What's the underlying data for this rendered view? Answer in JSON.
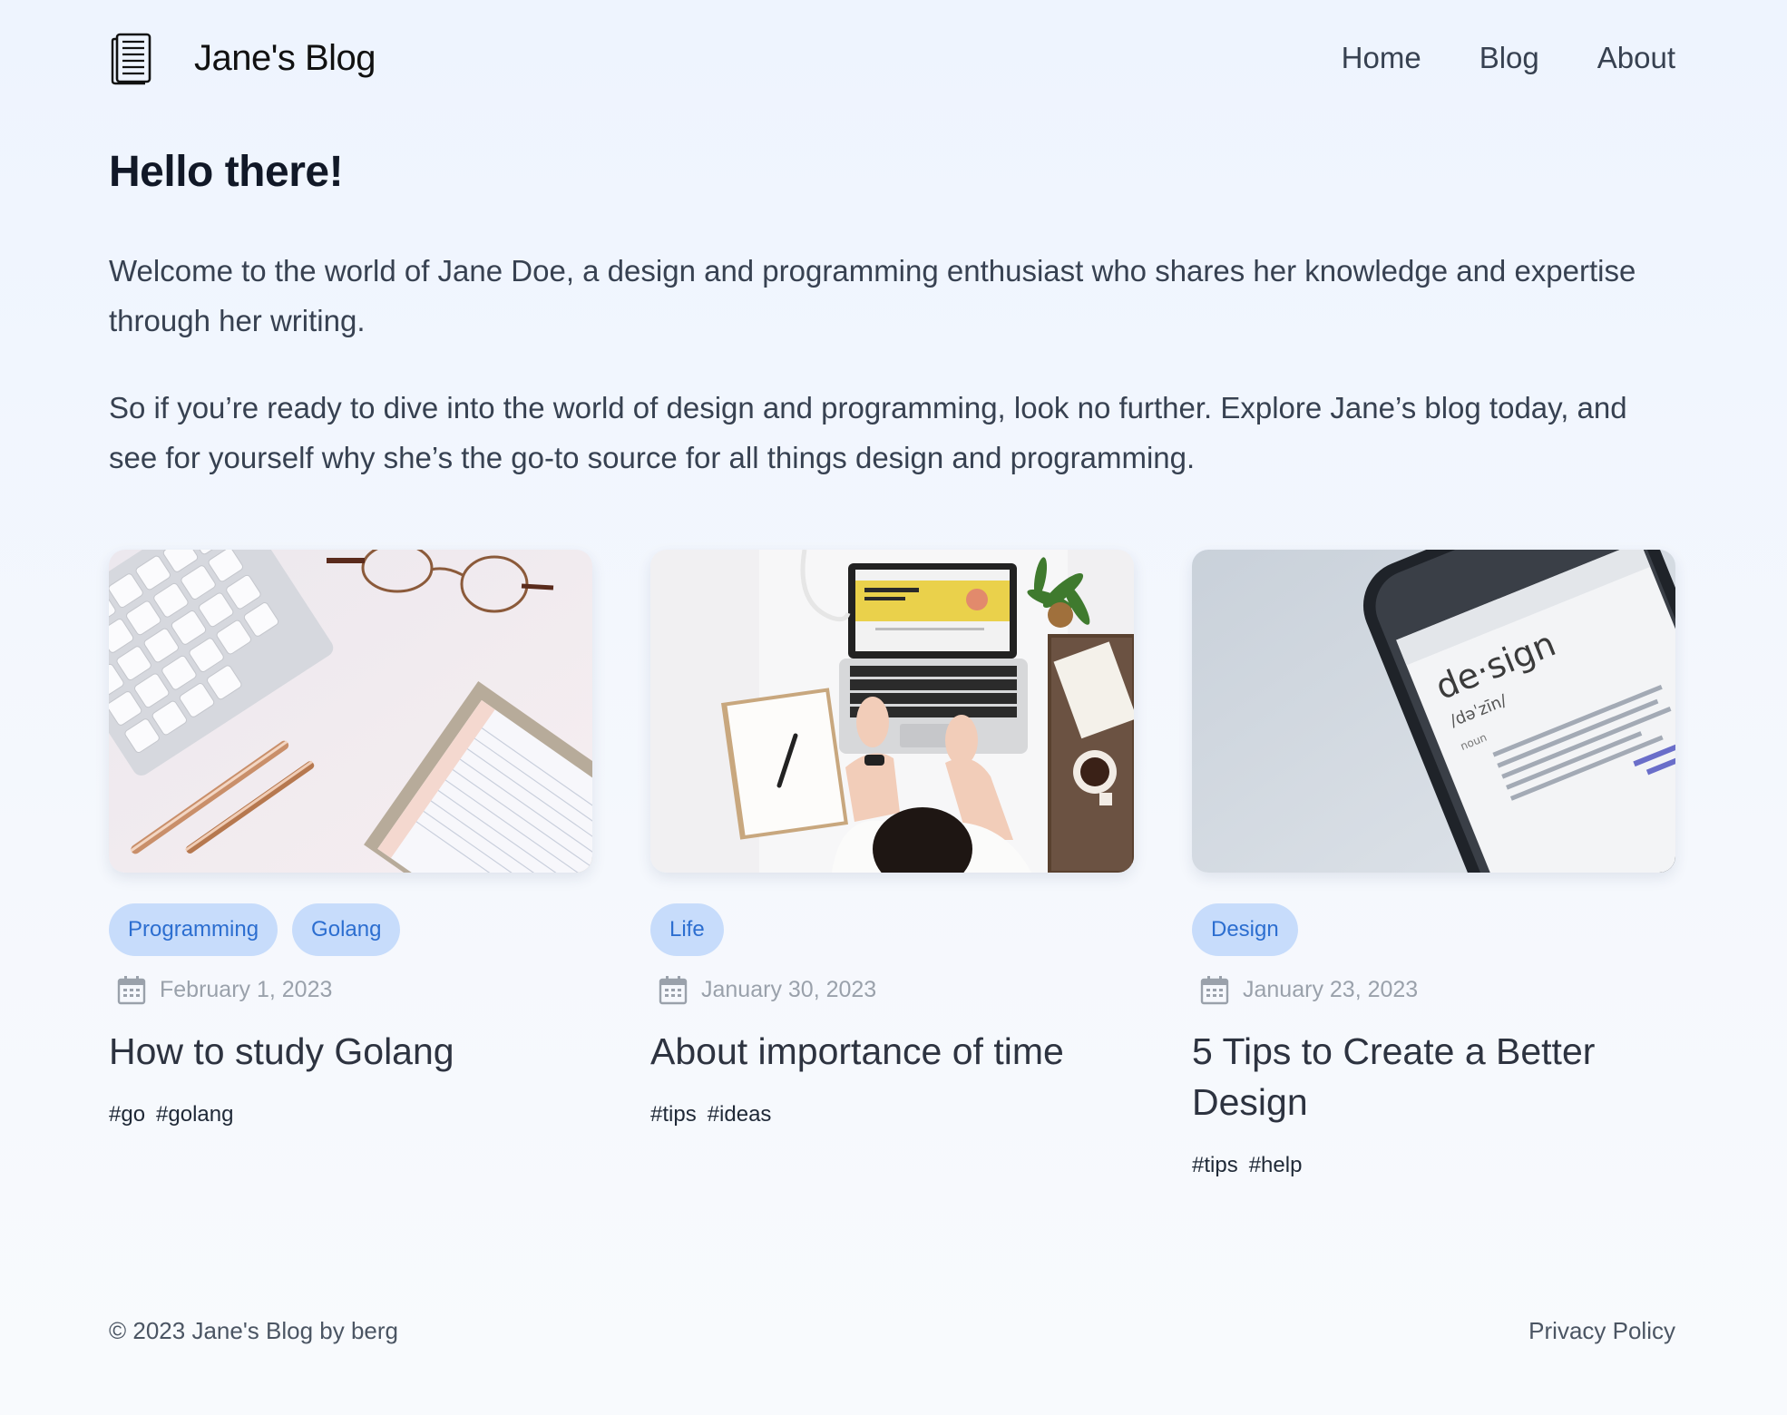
{
  "header": {
    "brand_icon": "document-icon",
    "brand_title": "Jane's Blog",
    "nav": [
      {
        "label": "Home"
      },
      {
        "label": "Blog"
      },
      {
        "label": "About"
      }
    ]
  },
  "intro": {
    "heading": "Hello there!",
    "paragraph_1": "Welcome to the world of Jane Doe, a design and programming enthusiast who shares her knowledge and expertise through her writing.",
    "paragraph_2": "So if you’re ready to dive into the world of design and programming, look no further. Explore Jane’s blog today, and see for yourself why she’s the go-to source for all things design and programming."
  },
  "posts": [
    {
      "image": "desk-keyboard-glasses-notebook-photo",
      "categories": [
        "Programming",
        "Golang"
      ],
      "date_icon": "calendar-icon",
      "date": "February 1, 2023",
      "title": "How to study Golang",
      "hashtags": [
        "#go",
        "#golang"
      ]
    },
    {
      "image": "woman-typing-laptop-photo",
      "categories": [
        "Life"
      ],
      "date_icon": "calendar-icon",
      "date": "January 30, 2023",
      "title": "About importance of time",
      "hashtags": [
        "#tips",
        "#ideas"
      ]
    },
    {
      "image": "phone-design-definition-photo",
      "categories": [
        "Design"
      ],
      "date_icon": "calendar-icon",
      "date": "January 23, 2023",
      "title": "5 Tips to Create a Better Design",
      "hashtags": [
        "#tips",
        "#help"
      ]
    }
  ],
  "footer": {
    "copyright": "© 2023 Jane's Blog by berg",
    "privacy_link": "Privacy Policy"
  },
  "colors": {
    "tag_bg": "#c7dcfb",
    "tag_text": "#2c6ed0",
    "page_bg": "#eef4fe"
  }
}
